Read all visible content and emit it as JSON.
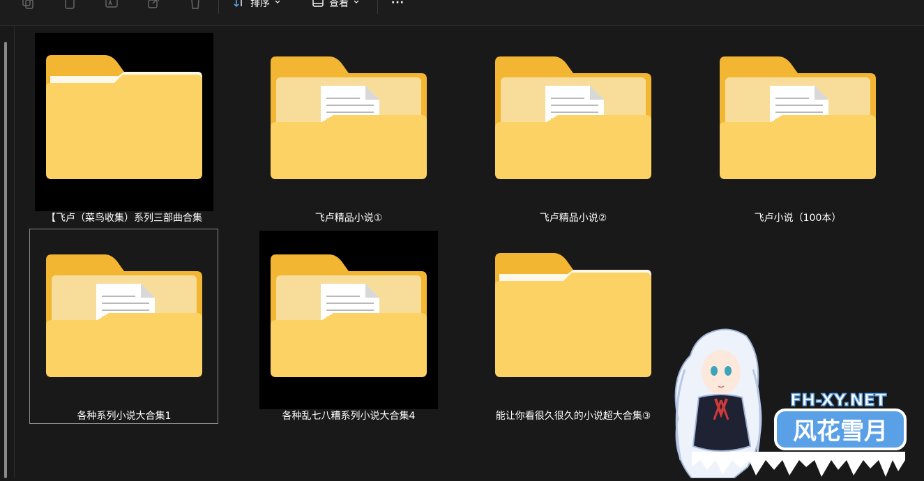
{
  "toolbar": {
    "sort_label": "排序",
    "view_label": "查看",
    "more_label": "···"
  },
  "folders": [
    {
      "name": "【飞卢（菜鸟收集）系列三部曲合集",
      "style": "plain",
      "thumb_bg": "black"
    },
    {
      "name": "飞卢精品小说①",
      "style": "document"
    },
    {
      "name": "飞卢精品小说②",
      "style": "document"
    },
    {
      "name": "飞卢小说（100本）",
      "style": "document"
    },
    {
      "name": "各种系列小说大合集1",
      "style": "document",
      "selected": true
    },
    {
      "name": "各种乱七八糟系列小说大合集4",
      "style": "document",
      "thumb_bg": "black"
    },
    {
      "name": "能让你看很久很久的小说超大合集③",
      "style": "plain"
    }
  ],
  "watermark": {
    "site": "FH-XY.NET",
    "name": "风花雪月"
  },
  "colors": {
    "background": "#191919",
    "folder_back": "#f2b632",
    "folder_front": "#fcd264",
    "accent_blue": "#5aa0e6"
  }
}
